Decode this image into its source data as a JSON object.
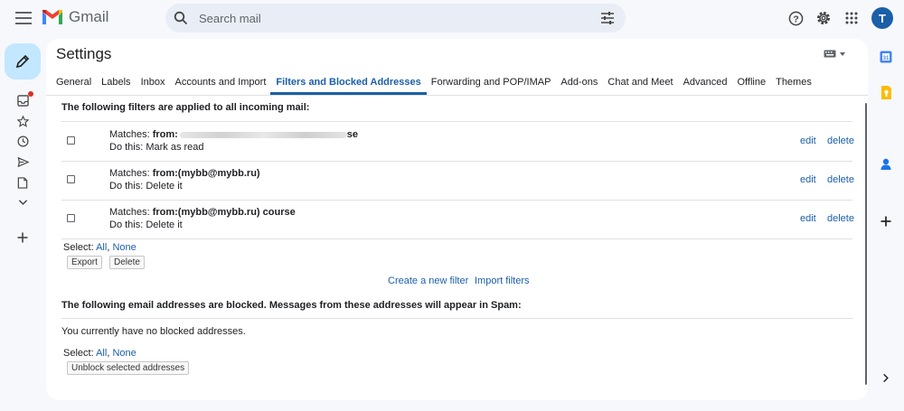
{
  "app": {
    "logo_text": "Gmail",
    "avatar_letter": "T"
  },
  "search": {
    "placeholder": "Search mail"
  },
  "page": {
    "title": "Settings"
  },
  "tabs": [
    {
      "label": "General"
    },
    {
      "label": "Labels"
    },
    {
      "label": "Inbox"
    },
    {
      "label": "Accounts and Import"
    },
    {
      "label": "Filters and Blocked Addresses",
      "active": true
    },
    {
      "label": "Forwarding and POP/IMAP"
    },
    {
      "label": "Add-ons"
    },
    {
      "label": "Chat and Meet"
    },
    {
      "label": "Advanced"
    },
    {
      "label": "Offline"
    },
    {
      "label": "Themes"
    }
  ],
  "filters": {
    "heading": "The following filters are applied to all incoming mail:",
    "items": [
      {
        "matches_label": "Matches: ",
        "criteria": "from:",
        "criteria_tail": "se",
        "action": "Do this: Mark as read",
        "edit": "edit",
        "delete": "delete"
      },
      {
        "matches_label": "Matches: ",
        "criteria": "from:(mybb@mybb.ru)",
        "action": "Do this: Delete it",
        "edit": "edit",
        "delete": "delete"
      },
      {
        "matches_label": "Matches: ",
        "criteria": "from:(mybb@mybb.ru) course",
        "action": "Do this: Delete it",
        "edit": "edit",
        "delete": "delete"
      }
    ],
    "select_prefix": "Select: ",
    "select_all": "All",
    "separator": ", ",
    "select_none": "None",
    "export_button": "Export",
    "delete_button": "Delete",
    "create_filter": "Create a new filter",
    "import_filters": "Import filters"
  },
  "blocked": {
    "heading": "The following email addresses are blocked. Messages from these addresses will appear in Spam:",
    "empty_message": "You currently have no blocked addresses.",
    "select_prefix": "Select: ",
    "select_all": "All",
    "separator": ", ",
    "select_none": "None",
    "unblock_button": "Unblock selected addresses"
  },
  "icons": {
    "top": [
      "menu-icon",
      "help-icon",
      "settings-icon",
      "apps-grid-icon"
    ],
    "rail": [
      "pencil-icon",
      "inbox-icon",
      "star-icon",
      "clock-icon",
      "send-icon",
      "draft-icon",
      "chevron-down-icon",
      "plus-icon"
    ],
    "side": [
      "calendar-icon",
      "keep-icon",
      "contacts-icon",
      "plus-icon",
      "chevron-right-icon"
    ]
  },
  "colors": {
    "accent": "#1a5fa8",
    "compose_bg": "#c2e7ff",
    "search_bg": "#e9eef6",
    "page_bg": "#f6f8fc",
    "notification_dot": "#d93025"
  }
}
